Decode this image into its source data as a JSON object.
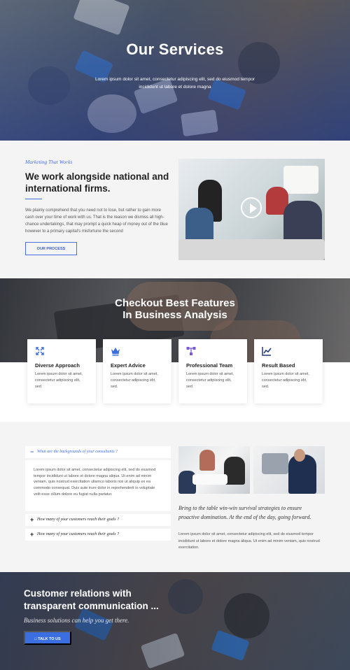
{
  "hero": {
    "title": "Our Services",
    "text": "Lorem ipsum dolor sit amet, consectetur adipiscing elit, sed do eiusmod tempor incididunt ut labore et dolore magna"
  },
  "about": {
    "eyebrow": "Marketing That Works",
    "heading": "We work alongside national and international firms.",
    "paragraph": "We plainly comprehend that you need not to lose, but rather to gain more cash over your time of work with us. That is the reason we dismiss all high-chance undertakings, that may prompt a quick heap of money out of the blue however to a primary capital's misfortune the second",
    "button_label": "OUR PROCESS"
  },
  "features": {
    "heading_line1": "Checkout Best Features",
    "heading_line2": "In Business Analysis",
    "cards": [
      {
        "title": "Diverse Approach",
        "text": "Lorem ipsum dolor sit amet, consectetur adipiscing elit, sed.",
        "icon": "expand-arrows-icon"
      },
      {
        "title": "Expert Advice",
        "text": "Lorem ipsum dolor sit amet, consectetur adipiscing elit, sed.",
        "icon": "crown-icon"
      },
      {
        "title": "Professional Team",
        "text": "Lorem ipsum dolor sit amet, consectetur adipiscing elit, sed.",
        "icon": "hierarchy-icon"
      },
      {
        "title": "Result Based",
        "text": "Lorem ipsum dolor sit amet, consectetur adipiscing elit, sed.",
        "icon": "line-chart-icon"
      }
    ]
  },
  "faq": {
    "items": [
      {
        "symbol": "−",
        "question": "What are the backgrounds of your consultants ?"
      },
      {
        "symbol": "+",
        "question": "How many of your customers reach their goals ?"
      },
      {
        "symbol": "+",
        "question": "How many of your customers reach their goals ?"
      }
    ],
    "answer": "Lorem ipsum dolor sit amet, consectetur adipiscing elit, sed do eiusmod tempor incididunt ut labore et dolore magna aliqua. Ut enim ad minim veniam, quis nostrud exercitation ullamco laboris nisi ut aliquip ex ea commodo consequat. Duis aute irure dolor in reprehenderit in voluptate velit esse cillum dolore eu fugiat nulla pariatur.",
    "quote": "Bring to the table win-win survival strategies to ensure proactive domination. At the end of the day, going forward.",
    "body": "Lorem ipsum dolor sit amet, consectetur adipiscing elit, sed do eiusmod tempor incididunt ut labore et dolore magna aliqua. Ut enim ad minim veniam, quis nostrud exercitation."
  },
  "cta": {
    "heading_line1": "Customer relations with",
    "heading_line2": "transparent communication ...",
    "subtitle": "Business solutions can help you get there.",
    "button_label": "TALK TO US"
  },
  "colors": {
    "accent": "#3b6fe0",
    "light_bg": "#f4f4f4"
  }
}
